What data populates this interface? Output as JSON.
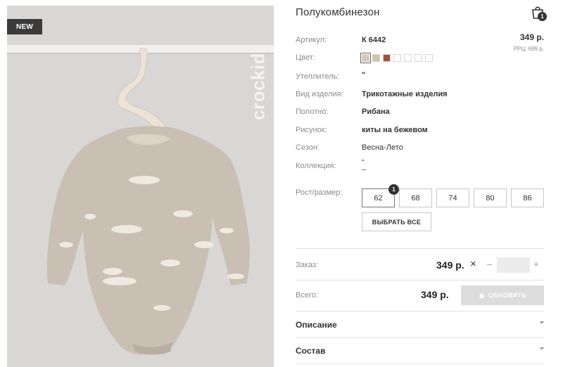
{
  "badge": "NEW",
  "brand": "crockid",
  "product": {
    "title": "Полукомбинезон",
    "price": "349 р.",
    "rrc": "РРЦ: 699 р."
  },
  "cart": {
    "count": "1"
  },
  "specs": {
    "article_label": "Артикул:",
    "article_value": "К 6442",
    "color_label": "Цвет:",
    "insulation_label": "Утеплитель:",
    "insulation_value": "\"",
    "type_label": "Вид изделия:",
    "type_value": "Трикотажные изделия",
    "fabric_label": "Полотно:",
    "fabric_value": "Рибана",
    "pattern_label": "Рисунок:",
    "pattern_value": "киты на бежевом",
    "season_label": "Сезон:",
    "season_value": "Весна-Лето",
    "collection_label": "Коллекция:",
    "collection_value_1": "\"",
    "collection_value_2": "–"
  },
  "swatch_colors": [
    "#d9cbb3",
    "#d3c2a6",
    "#a0503a",
    "#ffffff",
    "#ffffff",
    "#ffffff",
    "#ffffff"
  ],
  "sizes": {
    "label": "Рост/размер:",
    "options": [
      "62",
      "68",
      "74",
      "80",
      "86"
    ],
    "selected": "62",
    "selected_count": "1",
    "select_all": "ВЫБРАТЬ ВСЕ"
  },
  "order": {
    "label": "Заказ:",
    "price": "349 р.",
    "times": "×",
    "minus": "–",
    "plus": "+",
    "qty": ""
  },
  "total": {
    "label": "Всего:",
    "price": "349 р.",
    "update": "ОБНОВИТЬ"
  },
  "accordion": {
    "description": "Описание",
    "composition": "Состав"
  }
}
